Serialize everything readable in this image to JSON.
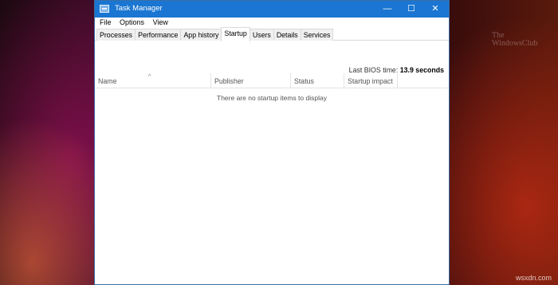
{
  "window": {
    "title": "Task Manager",
    "controls": {
      "minimize": "—",
      "maximize": "☐",
      "close": "✕"
    }
  },
  "menu": [
    "File",
    "Options",
    "View"
  ],
  "tabs": [
    "Processes",
    "Performance",
    "App history",
    "Startup",
    "Users",
    "Details",
    "Services"
  ],
  "active_tab": "Startup",
  "bios": {
    "label": "Last BIOS time:",
    "value": "13.9 seconds"
  },
  "columns": [
    "Name",
    "Publisher",
    "Status",
    "Startup impact"
  ],
  "sort_indicator": "^",
  "empty_message": "There are no startup items to display",
  "watermark": {
    "line1": "The",
    "line2": "WindowsClub",
    "url": "wsxdn.com"
  }
}
